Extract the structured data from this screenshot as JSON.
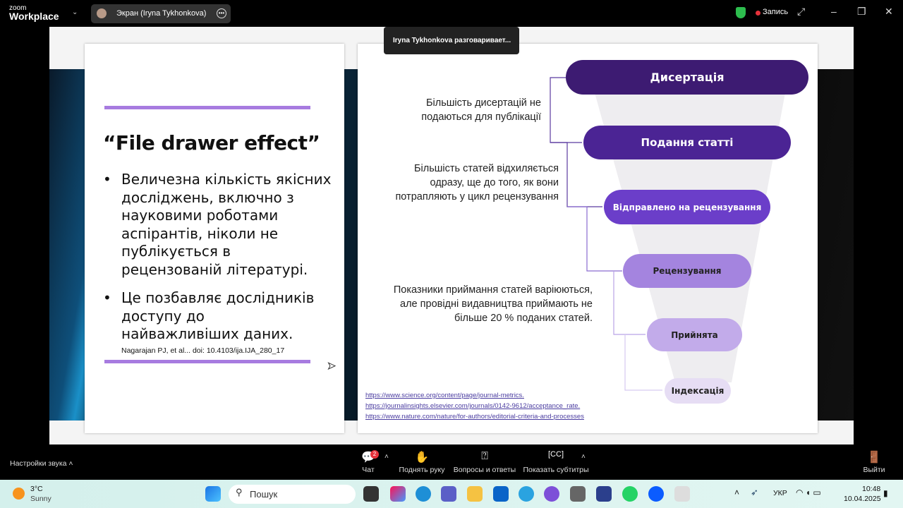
{
  "topbar": {
    "logo_small": "zoom",
    "logo_big": "Workplace",
    "share_label": "Экран (Iryna Tykhonkova)",
    "record_label": "Запись"
  },
  "tooltip": "Iryna Tykhonkova разговаривает...",
  "left_slide": {
    "title": "“File drawer effect”",
    "bullets": [
      "Величезна кількість якісних досліджень, включно з науковими роботами аспірантів, ніколи не публікується в рецензованій літературі.",
      "Це позбавляє дослідників доступу до найважливіших даних."
    ],
    "citation": "Nagarajan PJ, et al... doi: 10.4103/ija.IJA_280_17"
  },
  "right_slide": {
    "stages": [
      {
        "label": "Дисертація",
        "color": "#3d1b72"
      },
      {
        "label": "Подання статті",
        "color": "#4b2494"
      },
      {
        "label": "Відправлено на рецензування",
        "color": "#6b3ec9"
      },
      {
        "label": "Рецензування",
        "color": "#a484df"
      },
      {
        "label": "Прийнята",
        "color": "#c2abea"
      },
      {
        "label": "Індексація",
        "color": "#e6ddf4"
      }
    ],
    "notes": [
      "Більшість дисертацій не подаються для публікації",
      "Більшість статей відхиляється одразу, ще до того, як вони потрапляють у цикл рецензування",
      "Показники приймання статей варіюються, але провідні видавництва приймають не більше 20 % поданих статей."
    ],
    "links": [
      "https://www.science.org/content/page/journal-metrics.",
      "https://journalinsights.elsevier.com/journals/0142-9612/acceptance_rate.",
      "https://www.nature.com/nature/for-authors/editorial-criteria-and-processes"
    ]
  },
  "bottom": {
    "audio": "Настройки звука",
    "chat": "Чат",
    "chat_badge": "2",
    "raise_hand": "Поднять руку",
    "qa": "Вопросы и ответы",
    "captions": "Показать субтитры",
    "leave": "Выйти"
  },
  "taskbar": {
    "temp": "3°C",
    "weather": "Sunny",
    "search": "Пошук",
    "lang": "УКР",
    "time": "10:48",
    "date": "10.04.2025"
  }
}
